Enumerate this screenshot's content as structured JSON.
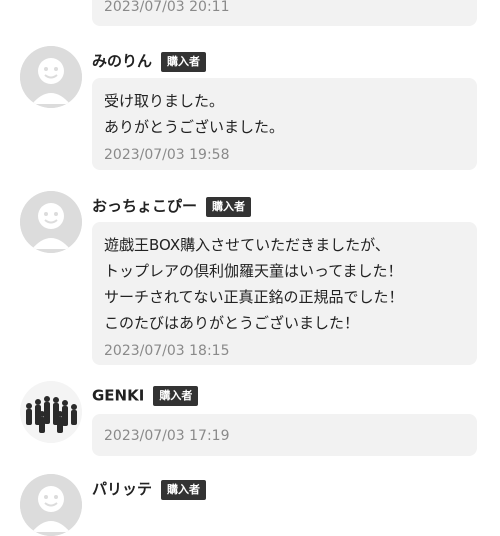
{
  "reviews": [
    {
      "name": "",
      "badge": "",
      "message": [],
      "timestamp": "2023/07/03 20:11"
    },
    {
      "name": "みのりん",
      "badge": "購入者",
      "message": [
        "受け取りました。",
        "ありがとうございました。"
      ],
      "timestamp": "2023/07/03 19:58",
      "avatar": "default-face-icon"
    },
    {
      "name": "おっちょこぴー",
      "badge": "購入者",
      "message": [
        "遊戯王BOX購入させていただきましたが、",
        "トップレアの倶利伽羅天童はいってました！",
        "サーチされてない正真正銘の正規品でした！",
        "このたびはありがとうございました！"
      ],
      "timestamp": "2023/07/03 18:15",
      "avatar": "default-face-icon"
    },
    {
      "name": "GENKI",
      "badge": "購入者",
      "message": [],
      "timestamp": "2023/07/03 17:19",
      "avatar": "group-photo-avatar"
    },
    {
      "name": "パリッテ",
      "badge": "購入者",
      "message": [],
      "timestamp": "",
      "avatar": "default-face-icon"
    }
  ]
}
